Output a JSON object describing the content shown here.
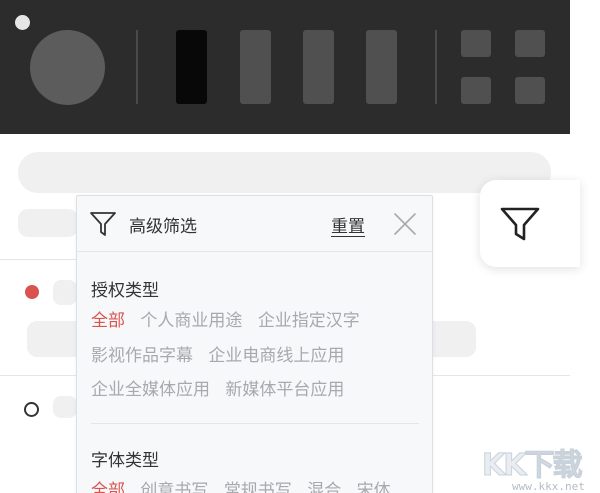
{
  "filter_panel": {
    "title": "高级筛选",
    "reset_label": "重置",
    "sections": [
      {
        "title": "授权类型",
        "options": [
          "全部",
          "个人商业用途",
          "企业指定汉字",
          "影视作品字幕",
          "企业电商线上应用",
          "企业全媒体应用",
          "新媒体平台应用"
        ],
        "selected": "全部"
      },
      {
        "title": "字体类型",
        "options": [
          "全部",
          "创意书写",
          "常规书写",
          "混合",
          "宋体"
        ],
        "selected": "全部"
      }
    ]
  },
  "icons": {
    "filter": "filter-icon",
    "close": "close-icon"
  },
  "colors": {
    "accent": "#d9534f",
    "toolbar_bg": "#2c2c2c",
    "option_text": "#a6a9ae",
    "panel_bg": "#f7f8fa"
  },
  "watermark": {
    "logo": "KK下载",
    "url": "www.kkx.net"
  }
}
